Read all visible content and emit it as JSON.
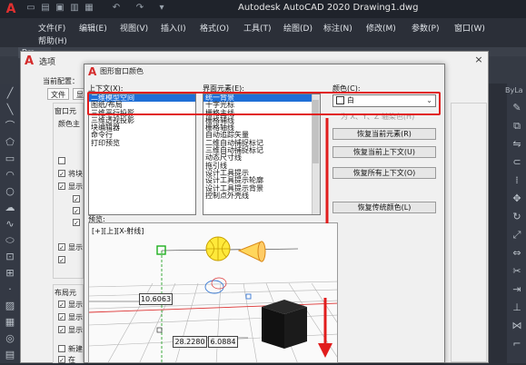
{
  "app": {
    "title": "Autodesk AutoCAD 2020    Drawing1.dwg",
    "logo": "A",
    "qat_icons": [
      "new-icon",
      "open-icon",
      "save-icon",
      "saveas-icon",
      "print-icon",
      "undo-icon",
      "redo-icon",
      "share-icon"
    ]
  },
  "menubar": {
    "items": [
      "文件(F)",
      "编辑(E)",
      "视图(V)",
      "插入(I)",
      "格式(O)",
      "工具(T)",
      "绘图(D)",
      "标注(N)",
      "修改(M)",
      "参数(P)",
      "窗口(W)",
      "帮助(H)"
    ]
  },
  "drawing_tab": "Dra",
  "bylayer": "ByLa",
  "options_dialog": {
    "logo": "A",
    "title": "选项",
    "close": "×",
    "current_profile": "当前配置：",
    "tabs": [
      "文件",
      "显"
    ],
    "window_elements": "窗口元",
    "color_scheme": "颜色主",
    "checkbox_labels": [
      "将块",
      "显示",
      "显示"
    ],
    "layout_elements": "布局元",
    "layout_checkbox_labels": [
      "显示",
      "显示",
      "显示",
      "新建",
      "在"
    ]
  },
  "color_dialog": {
    "logo": "A",
    "title": "图形窗口颜色",
    "context_label": "上下文(X):",
    "context_items": [
      "二维模型空间",
      "图纸/布局",
      "三维平行投影",
      "三维透视投影",
      "块编辑器",
      "命令行",
      "打印预览"
    ],
    "interface_label": "界面元素(E):",
    "interface_items": [
      "统一背景",
      "十字光标",
      "栅格主线",
      "栅格辅线",
      "栅格轴线",
      "自动追踪矢量",
      "二维自动捕捉标记",
      "三维自动捕捉标记",
      "动态尺寸线",
      "拖引线",
      "设计工具提示",
      "设计工具提示轮廓",
      "设计工具提示背景",
      "控制点外壳线"
    ],
    "color_label": "颜色(C):",
    "color_value": "白",
    "tint_label": "为 X、Y、Z 轴染色(H)",
    "buttons": {
      "restore_element": "恢复当前元素(R)",
      "restore_context": "恢复当前上下文(U)",
      "restore_all": "恢复所有上下文(O)",
      "restore_classic": "恢复传统颜色(L)"
    },
    "preview_label": "预览:",
    "viewport_label": "[+][上][X-射线]",
    "dimensions": [
      "10.6063",
      "28.2280",
      "6.0884"
    ]
  }
}
